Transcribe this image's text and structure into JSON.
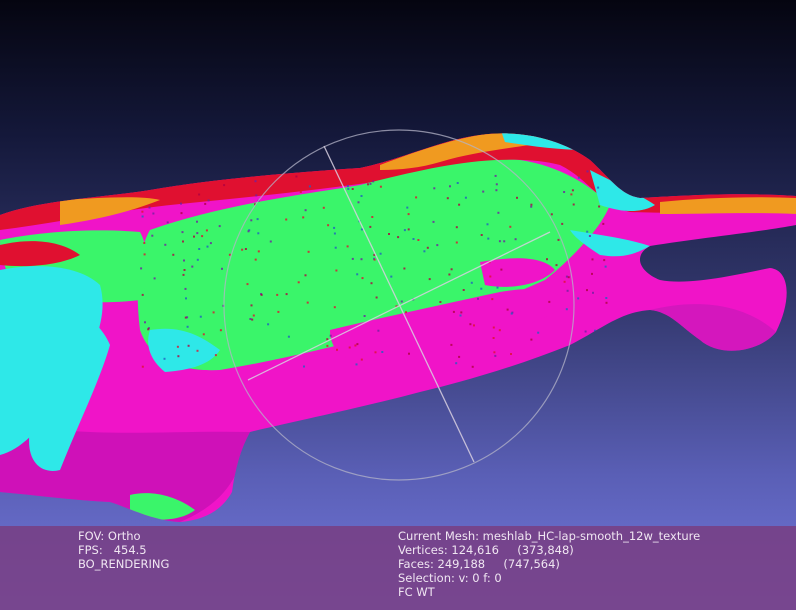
{
  "colors": {
    "background_top": "#050510",
    "background_bottom": "#7478dc",
    "mesh_magenta": "#f014c8",
    "mesh_green": "#3af56a",
    "mesh_cyan": "#2ee8e8",
    "mesh_red": "#e01030",
    "mesh_orange": "#f09a20",
    "trackball": "#b4b4c8",
    "info_panel": "#783e82"
  },
  "info_left": {
    "fov": "FOV: Ortho",
    "fps": "FPS:   454.5",
    "rendering": "BO_RENDERING"
  },
  "info_right": {
    "current_mesh": "Current Mesh: meshlab_HC-lap-smooth_12w_texture",
    "vertices": "Vertices: 124,616     (373,848)",
    "faces": "Faces: 249,188     (747,564)",
    "selection": "Selection: v: 0 f: 0",
    "mode": "FC WT"
  }
}
